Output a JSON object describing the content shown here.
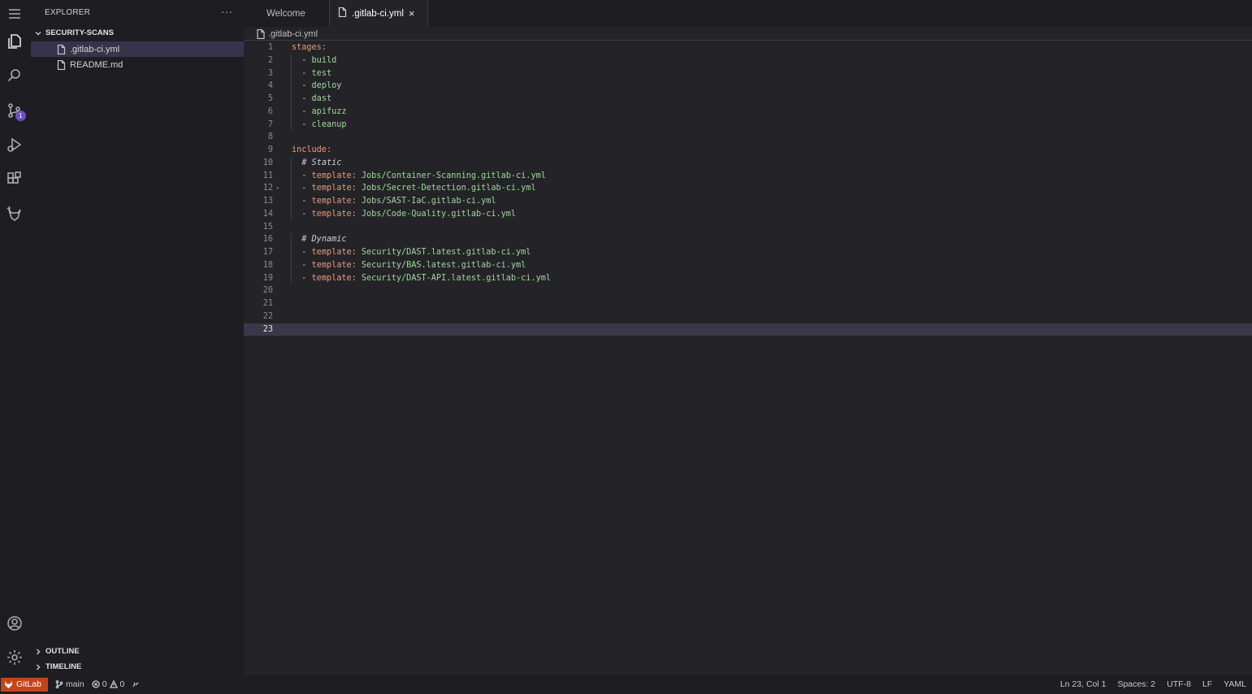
{
  "activity_bar": {
    "scm_badge": "1",
    "icons": [
      "menu-icon",
      "explorer-icon",
      "search-icon",
      "source-control-icon",
      "run-debug-icon",
      "extensions-icon",
      "gitlab-workflow-icon",
      "account-icon",
      "settings-gear-icon"
    ]
  },
  "sidebar": {
    "title": "EXPLORER",
    "more": "···",
    "folder": "SECURITY-SCANS",
    "files": [
      {
        "name": ".gitlab-ci.yml",
        "active": true
      },
      {
        "name": "README.md",
        "active": false
      }
    ],
    "outline": "OUTLINE",
    "timeline": "TIMELINE"
  },
  "tabs": [
    {
      "label": "Welcome"
    },
    {
      "label": ".gitlab-ci.yml",
      "close": "×"
    }
  ],
  "breadcrumb": ".gitlab-ci.yml",
  "code": {
    "current_line": 23,
    "line_numbers": [
      "1",
      "2",
      "3",
      "4",
      "5",
      "6",
      "7",
      "8",
      "9",
      "10",
      "11",
      "12",
      "13",
      "14",
      "15",
      "16",
      "17",
      "18",
      "19",
      "20",
      "21",
      "22",
      "23"
    ],
    "lines": [
      {
        "key": "stages",
        "value": ""
      },
      {
        "item": "build"
      },
      {
        "item": "test"
      },
      {
        "item": "deploy"
      },
      {
        "item": "dast"
      },
      {
        "item": "apifuzz"
      },
      {
        "item": "cleanup"
      },
      {},
      {
        "key": "include",
        "value": ""
      },
      {
        "comment": "# Static"
      },
      {
        "tkey": "template",
        "tval": "Jobs/Container-Scanning.gitlab-ci.yml"
      },
      {
        "tkey": "template",
        "tval": "Jobs/Secret-Detection.gitlab-ci.yml"
      },
      {
        "tkey": "template",
        "tval": "Jobs/SAST-IaC.gitlab-ci.yml"
      },
      {
        "tkey": "template",
        "tval": "Jobs/Code-Quality.gitlab-ci.yml"
      },
      {},
      {
        "comment": "# Dynamic"
      },
      {
        "tkey": "template",
        "tval": "Security/DAST.latest.gitlab-ci.yml"
      },
      {
        "tkey": "template",
        "tval": "Security/BAS.latest.gitlab-ci.yml"
      },
      {
        "tkey": "template",
        "tval": "Security/DAST-API.latest.gitlab-ci.yml"
      },
      {},
      {},
      {},
      {}
    ]
  },
  "statusbar": {
    "gitlab": "GitLab",
    "branch": "main",
    "errors": "0",
    "warnings": "0",
    "position": "Ln 23, Col 1",
    "spaces": "Spaces: 2",
    "encoding": "UTF-8",
    "eol": "LF",
    "language": "YAML"
  }
}
